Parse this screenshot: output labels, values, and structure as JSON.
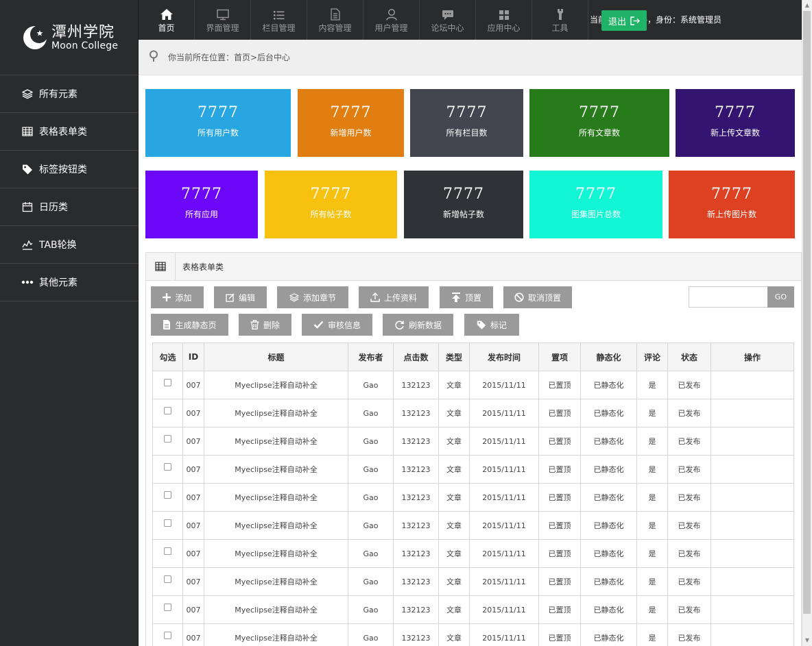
{
  "brand": {
    "name_cn": "潭州学院",
    "name_en": "Moon College"
  },
  "sidebar": {
    "items": [
      {
        "label": "所有元素",
        "icon": "layers-icon"
      },
      {
        "label": "表格表单类",
        "icon": "table-icon"
      },
      {
        "label": "标签按钮类",
        "icon": "tag-icon"
      },
      {
        "label": "日历类",
        "icon": "calendar-icon"
      },
      {
        "label": "TAB轮换",
        "icon": "activity-icon"
      },
      {
        "label": "其他元素",
        "icon": "more-icon"
      }
    ]
  },
  "topnav": {
    "items": [
      {
        "label": "首页",
        "icon": "home-icon",
        "active": true
      },
      {
        "label": "界面管理",
        "icon": "monitor-icon"
      },
      {
        "label": "栏目管理",
        "icon": "list-icon"
      },
      {
        "label": "内容管理",
        "icon": "document-icon"
      },
      {
        "label": "用户管理",
        "icon": "user-icon"
      },
      {
        "label": "论坛中心",
        "icon": "chat-icon"
      },
      {
        "label": "应用中心",
        "icon": "grid-icon"
      },
      {
        "label": "工具",
        "icon": "wrench-icon"
      }
    ],
    "user_info": "当前用户：Gao，身份：系统管理员",
    "logout_label": "退出"
  },
  "breadcrumb": {
    "text": "你当前所在位置：首页>后台中心"
  },
  "stats": [
    {
      "value": "7777",
      "label": "所有用户数",
      "color": "#27a6e1"
    },
    {
      "value": "7777",
      "label": "新增用户数",
      "color": "#e07e12"
    },
    {
      "value": "7777",
      "label": "所有栏目数",
      "color": "#43464e"
    },
    {
      "value": "7777",
      "label": "所有文章数",
      "color": "#277b1b"
    },
    {
      "value": "7777",
      "label": "新上传文章数",
      "color": "#331470"
    },
    {
      "value": "7777",
      "label": "所有应用",
      "color": "#6b06f6"
    },
    {
      "value": "7777",
      "label": "所有帖子数",
      "color": "#f6c10f"
    },
    {
      "value": "7777",
      "label": "新增帖子数",
      "color": "#2f3236"
    },
    {
      "value": "7777",
      "label": "图集图片总数",
      "color": "#12f6d5"
    },
    {
      "value": "7777",
      "label": "新上传图片数",
      "color": "#dd4121"
    }
  ],
  "panel": {
    "title": "表格表单类",
    "buttons": [
      {
        "label": "添加",
        "icon": "plus-icon"
      },
      {
        "label": "编辑",
        "icon": "edit-icon"
      },
      {
        "label": "添加章节",
        "icon": "layers-icon"
      },
      {
        "label": "上传资料",
        "icon": "upload-icon"
      },
      {
        "label": "顶置",
        "icon": "pin-top-icon"
      },
      {
        "label": "取消顶置",
        "icon": "ban-icon"
      },
      {
        "label": "生成静态页",
        "icon": "file-icon"
      },
      {
        "label": "删除",
        "icon": "trash-icon"
      },
      {
        "label": "审核信息",
        "icon": "check-icon"
      },
      {
        "label": "刷新数据",
        "icon": "refresh-icon"
      },
      {
        "label": "标记",
        "icon": "tag-icon"
      }
    ],
    "search": {
      "placeholder": "",
      "go_label": "GO"
    }
  },
  "table": {
    "headers": [
      "勾选",
      "ID",
      "标题",
      "发布者",
      "点击数",
      "类型",
      "发布时间",
      "置项",
      "静态化",
      "评论",
      "状态",
      "操作"
    ],
    "rows": [
      [
        "",
        "007",
        "Myeclipse注释自动补全",
        "Gao",
        "132123",
        "文章",
        "2015/11/11",
        "已置顶",
        "已静态化",
        "是",
        "已发布",
        ""
      ],
      [
        "",
        "007",
        "Myeclipse注释自动补全",
        "Gao",
        "132123",
        "文章",
        "2015/11/11",
        "已置顶",
        "已静态化",
        "是",
        "已发布",
        ""
      ],
      [
        "",
        "007",
        "Myeclipse注释自动补全",
        "Gao",
        "132123",
        "文章",
        "2015/11/11",
        "已置顶",
        "已静态化",
        "是",
        "已发布",
        ""
      ],
      [
        "",
        "007",
        "Myeclipse注释自动补全",
        "Gao",
        "132123",
        "文章",
        "2015/11/11",
        "已置顶",
        "已静态化",
        "是",
        "已发布",
        ""
      ],
      [
        "",
        "007",
        "Myeclipse注释自动补全",
        "Gao",
        "132123",
        "文章",
        "2015/11/11",
        "已置顶",
        "已静态化",
        "是",
        "已发布",
        ""
      ],
      [
        "",
        "007",
        "Myeclipse注释自动补全",
        "Gao",
        "132123",
        "文章",
        "2015/11/11",
        "已置顶",
        "已静态化",
        "是",
        "已发布",
        ""
      ],
      [
        "",
        "007",
        "Myeclipse注释自动补全",
        "Gao",
        "132123",
        "文章",
        "2015/11/11",
        "已置顶",
        "已静态化",
        "是",
        "已发布",
        ""
      ],
      [
        "",
        "007",
        "Myeclipse注释自动补全",
        "Gao",
        "132123",
        "文章",
        "2015/11/11",
        "已置顶",
        "已静态化",
        "是",
        "已发布",
        ""
      ],
      [
        "",
        "007",
        "Myeclipse注释自动补全",
        "Gao",
        "132123",
        "文章",
        "2015/11/11",
        "已置顶",
        "已静态化",
        "是",
        "已发布",
        ""
      ],
      [
        "",
        "007",
        "Myeclipse注释自动补全",
        "Gao",
        "132123",
        "文章",
        "2015/11/11",
        "已置顶",
        "已静态化",
        "是",
        "已发布",
        ""
      ]
    ]
  }
}
